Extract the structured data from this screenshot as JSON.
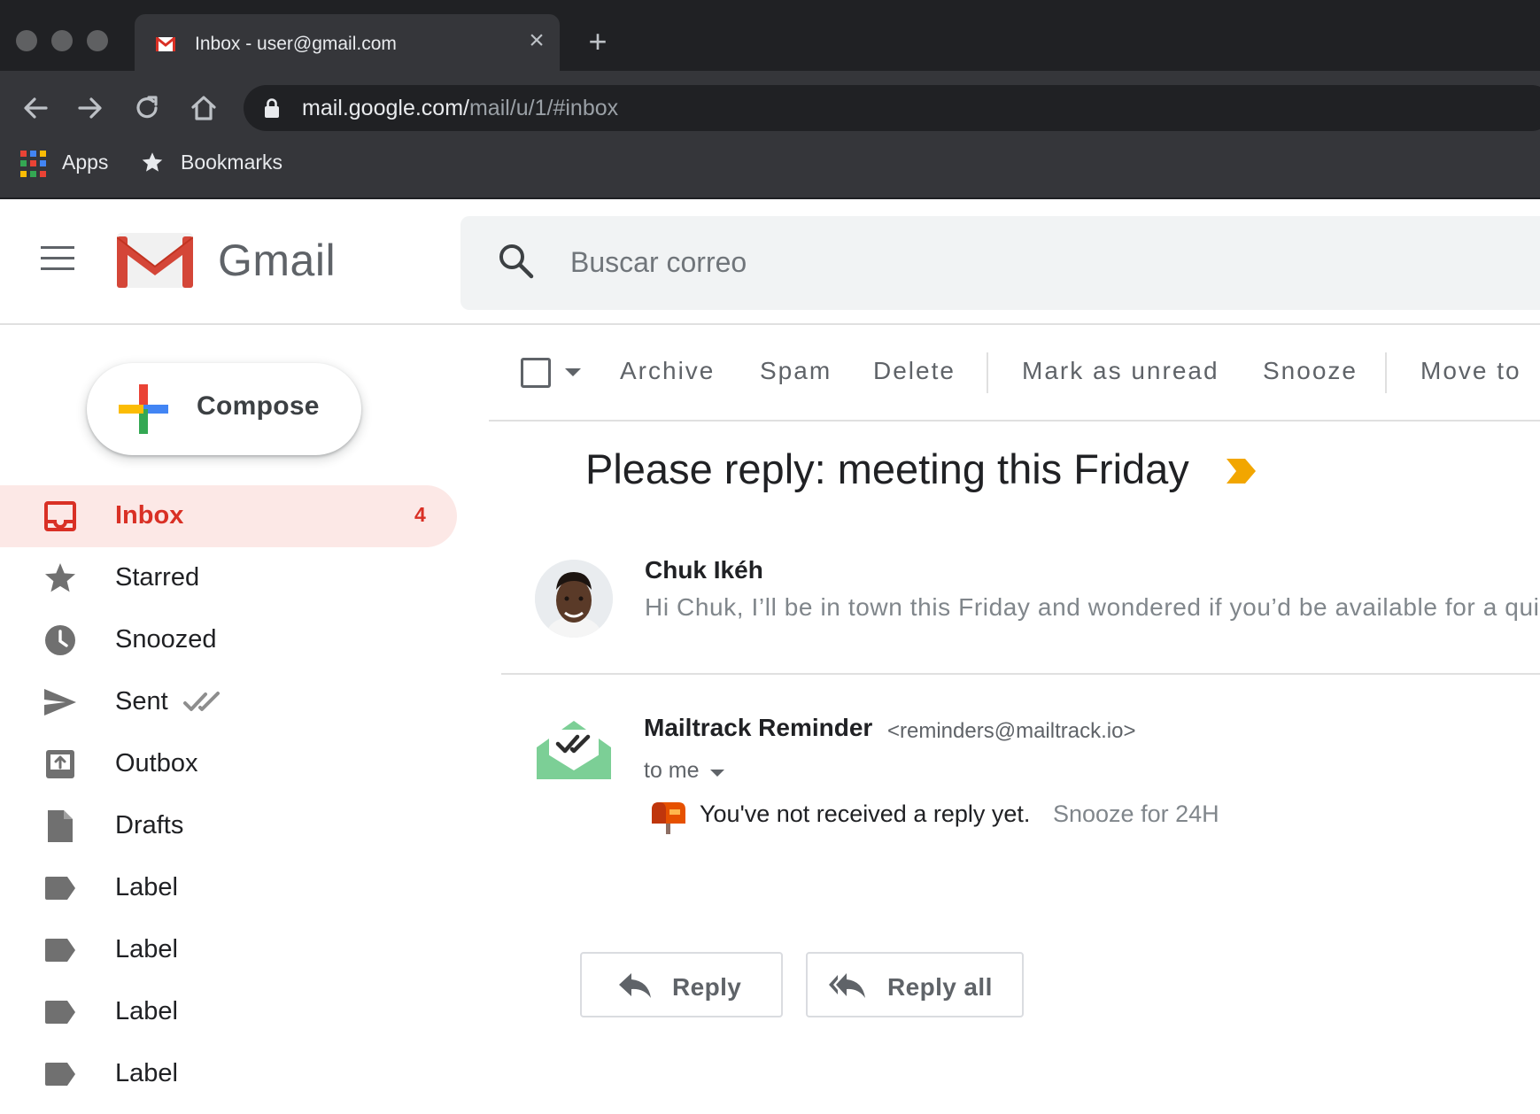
{
  "browser": {
    "tab_title": "Inbox - user@gmail.com",
    "tab_close": "×",
    "new_tab": "+",
    "url_host": "mail.google.com/",
    "url_path": "mail/u/1/#inbox",
    "bookmarks": {
      "apps": "Apps",
      "bookmarks": "Bookmarks"
    }
  },
  "header": {
    "app_name": "Gmail",
    "search_placeholder": "Buscar correo"
  },
  "compose": {
    "label": "Compose"
  },
  "sidebar": {
    "items": [
      {
        "label": "Inbox",
        "count": "4",
        "icon": "inbox-icon",
        "active": true
      },
      {
        "label": "Starred",
        "icon": "star-icon"
      },
      {
        "label": "Snoozed",
        "icon": "clock-icon"
      },
      {
        "label": "Sent",
        "icon": "send-icon"
      },
      {
        "label": "Outbox",
        "icon": "outbox-icon"
      },
      {
        "label": "Drafts",
        "icon": "draft-icon"
      },
      {
        "label": "Label",
        "icon": "label-icon"
      },
      {
        "label": "Label",
        "icon": "label-icon"
      },
      {
        "label": "Label",
        "icon": "label-icon"
      },
      {
        "label": "Label",
        "icon": "label-icon"
      }
    ]
  },
  "toolbar": {
    "archive": "Archive",
    "spam": "Spam",
    "delete": "Delete",
    "mark_unread": "Mark as unread",
    "snooze": "Snooze",
    "move_to": "Move to"
  },
  "thread": {
    "subject": "Please reply: meeting this Friday",
    "messages": [
      {
        "sender": "Chuk Ikéh",
        "snippet": "Hi Chuk, I’ll be in town this Friday and wondered if you’d be available for a quick"
      },
      {
        "sender": "Mailtrack Reminder",
        "email": "<reminders@mailtrack.io>",
        "recipient": "to me",
        "body": "You've not received a reply yet.",
        "snooze_link": "Snooze for 24H"
      }
    ],
    "reply": "Reply",
    "reply_all": "Reply all"
  },
  "colors": {
    "accent_red": "#d93025",
    "active_bg": "#fce8e6",
    "importance": "#f2a600",
    "mailtrack_green": "#7ccf96"
  }
}
